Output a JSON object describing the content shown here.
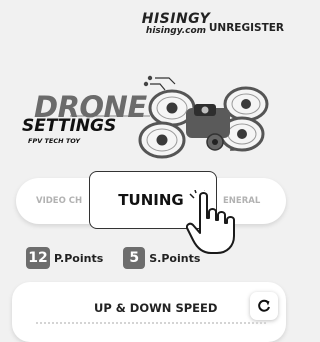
{
  "header": {
    "logo_top": "HISINGY",
    "logo_bottom": "hisingy.com",
    "unregister_label": "UNREGISTER"
  },
  "banner": {
    "title": "DRONE",
    "subtitle": "SETTINGS",
    "tagline": "FPV TECH TOY",
    "icon": "fpv-drone-illustration"
  },
  "tabs": {
    "items": [
      "VIDEO CH",
      "TUNING",
      "GENERAL"
    ],
    "visible_labels": {
      "video": "VIDEO CH",
      "tuning": "TUNING",
      "general": "ENERAL"
    },
    "selected": "TUNING"
  },
  "points": {
    "p_value": "12",
    "p_label": "P.Points",
    "s_value": "5",
    "s_label": "S.Points"
  },
  "speed": {
    "title": "UP & DOWN SPEED",
    "reset_icon": "reset-icon"
  },
  "colors": {
    "background": "#f1f1f1",
    "card": "#ffffff",
    "badge": "#6d6d6d",
    "muted_tab": "#b2b2b2"
  }
}
